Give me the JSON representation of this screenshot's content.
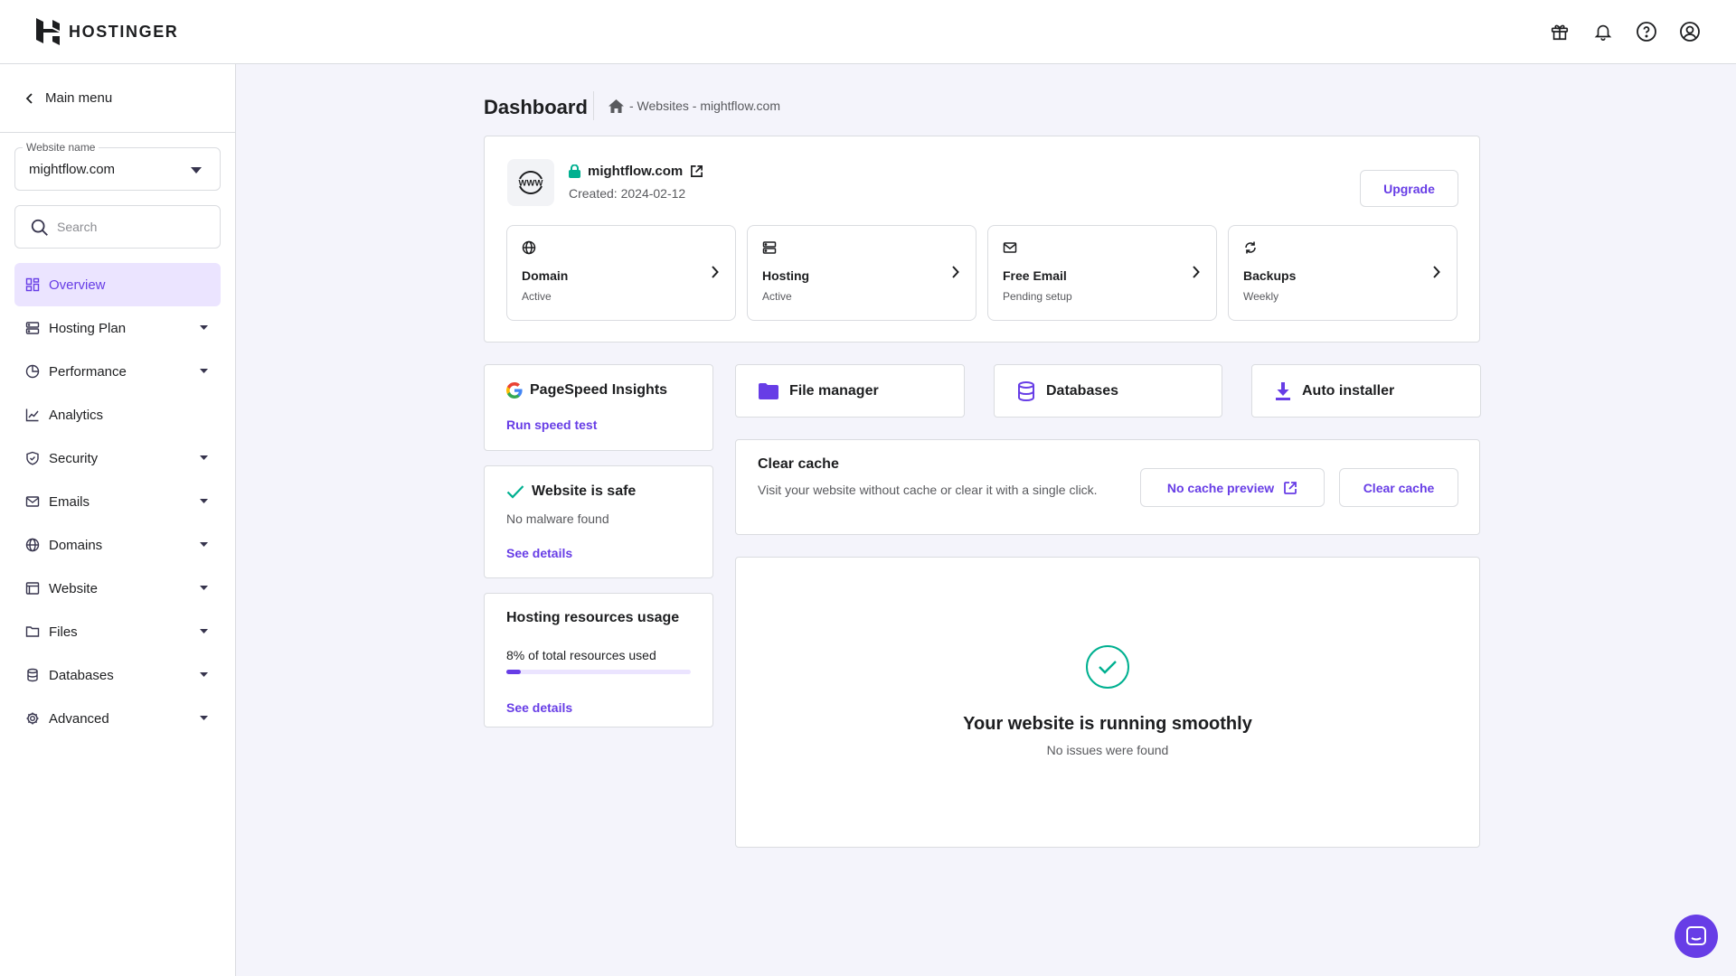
{
  "brand": {
    "name": "HOSTINGER"
  },
  "header": {
    "icons": [
      "gift-icon",
      "bell-icon",
      "help-icon",
      "account-icon"
    ]
  },
  "sidebar": {
    "back_label": "Main menu",
    "website_select": {
      "legend": "Website name",
      "value": "mightflow.com"
    },
    "search": {
      "placeholder": "Search"
    },
    "items": [
      {
        "label": "Overview",
        "icon": "grid-icon",
        "active": true,
        "has_caret": false
      },
      {
        "label": "Hosting Plan",
        "icon": "server-icon",
        "has_caret": true
      },
      {
        "label": "Performance",
        "icon": "pie-chart-icon",
        "has_caret": true
      },
      {
        "label": "Analytics",
        "icon": "trend-icon",
        "has_caret": false
      },
      {
        "label": "Security",
        "icon": "shield-icon",
        "has_caret": true
      },
      {
        "label": "Emails",
        "icon": "mail-icon",
        "has_caret": true
      },
      {
        "label": "Domains",
        "icon": "globe-icon",
        "has_caret": true
      },
      {
        "label": "Website",
        "icon": "browser-icon",
        "has_caret": true
      },
      {
        "label": "Files",
        "icon": "folder-icon",
        "has_caret": true
      },
      {
        "label": "Databases",
        "icon": "database-icon",
        "has_caret": true
      },
      {
        "label": "Advanced",
        "icon": "gear-icon",
        "has_caret": true
      }
    ]
  },
  "page": {
    "title": "Dashboard",
    "breadcrumb": "- Websites - mightflow.com"
  },
  "site": {
    "domain": "mightflow.com",
    "created": "Created: 2024-02-12",
    "upgrade_label": "Upgrade",
    "tiles": [
      {
        "name": "Domain",
        "status": "Active",
        "icon": "globe-icon"
      },
      {
        "name": "Hosting",
        "status": "Active",
        "icon": "server-icon"
      },
      {
        "name": "Free Email",
        "status": "Pending setup",
        "icon": "mail-icon"
      },
      {
        "name": "Backups",
        "status": "Weekly",
        "icon": "refresh-icon"
      }
    ]
  },
  "pagespeed": {
    "title": "PageSpeed Insights",
    "link": "Run speed test"
  },
  "security": {
    "title": "Website is safe",
    "subtitle": "No malware found",
    "link": "See details"
  },
  "resources": {
    "title": "Hosting resources usage",
    "usage_text": "8% of total resources used",
    "usage_fraction": 0.08,
    "link": "See details"
  },
  "quick_actions": [
    {
      "label": "File manager",
      "icon": "folder-icon"
    },
    {
      "label": "Databases",
      "icon": "database-icon"
    },
    {
      "label": "Auto installer",
      "icon": "download-icon"
    }
  ],
  "cache": {
    "title": "Clear cache",
    "description": "Visit your website without cache or clear it with a single click.",
    "preview_label": "No cache preview",
    "clear_label": "Clear cache"
  },
  "status": {
    "title": "Your website is running smoothly",
    "subtitle": "No issues were found"
  },
  "colors": {
    "accent": "#673de6",
    "accent_light": "#ebe4ff",
    "success": "#00b090",
    "text": "#1d1e20",
    "muted": "#595a5e",
    "border": "#dadce0"
  }
}
